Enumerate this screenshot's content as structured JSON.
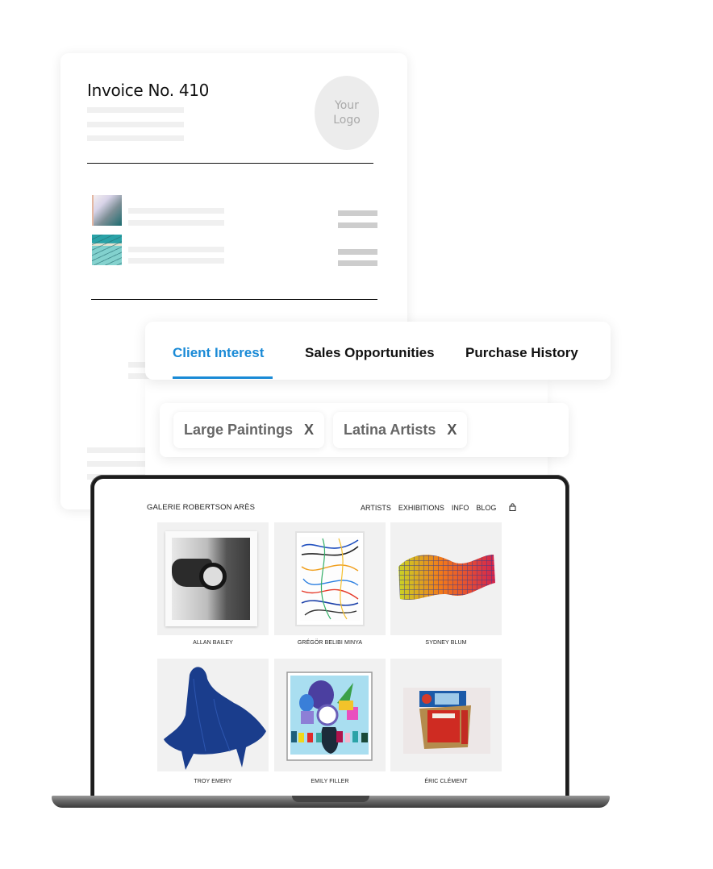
{
  "invoice": {
    "title": "Invoice No. 410",
    "logo_placeholder": "Your Logo"
  },
  "tabs": {
    "items": [
      {
        "label": "Client Interest",
        "active": true
      },
      {
        "label": "Sales Opportunities",
        "active": false
      },
      {
        "label": "Purchase History",
        "active": false
      }
    ],
    "accent_color": "#1a8ad6"
  },
  "chips": [
    {
      "label": "Large Paintings",
      "remove": "X"
    },
    {
      "label": "Latina Artists",
      "remove": "X"
    }
  ],
  "website": {
    "title": "GALERIE ROBERTSON ARÈS",
    "nav": [
      "ARTISTS",
      "EXHIBITIONS",
      "INFO",
      "BLOG"
    ],
    "cart_icon": "shopping-bag-icon",
    "artists": [
      {
        "name": "ALLAN BAILEY"
      },
      {
        "name": "GRÉGÖR BELIBI MINYA"
      },
      {
        "name": "SYDNEY BLUM"
      },
      {
        "name": "TROY EMERY"
      },
      {
        "name": "EMILY FILLER"
      },
      {
        "name": "ÉRIC CLÉMENT"
      }
    ]
  }
}
